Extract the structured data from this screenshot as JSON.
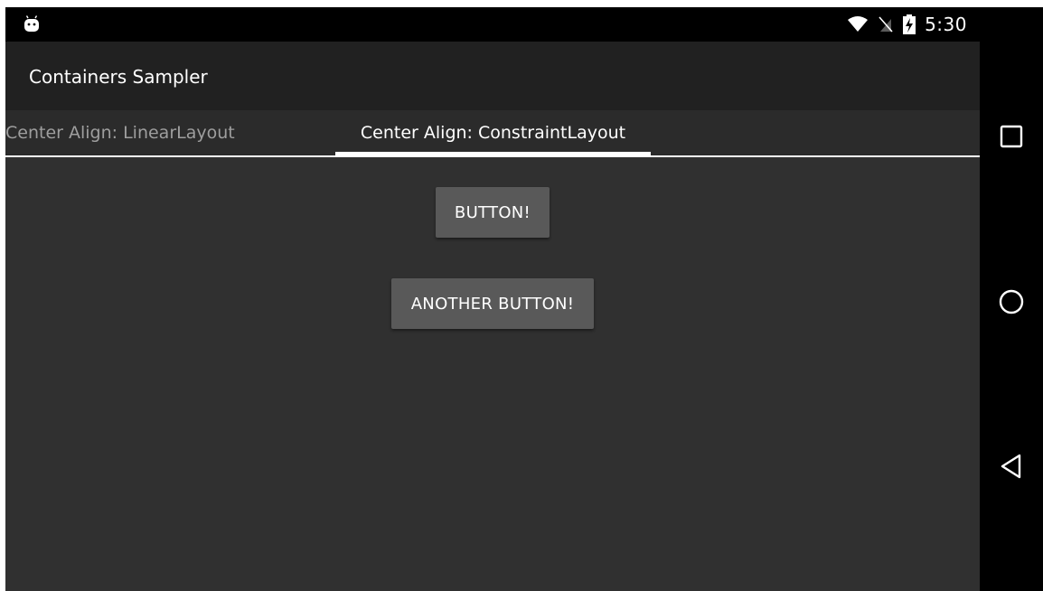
{
  "status_bar": {
    "time": "5:30",
    "icons": [
      "android-debug-icon",
      "wifi-icon",
      "no-sim-icon",
      "battery-charging-icon"
    ]
  },
  "action_bar": {
    "title": "Containers Sampler"
  },
  "tabs": [
    {
      "label": "Center Align: LinearLayout",
      "selected": false
    },
    {
      "label": "Center Align: ConstraintLayout",
      "selected": true
    }
  ],
  "content": {
    "button_1": "BUTTON!",
    "button_2": "ANOTHER BUTTON!"
  },
  "nav_bar": {
    "icons": [
      "recents-icon",
      "home-icon",
      "back-icon"
    ]
  },
  "colors": {
    "background": "#303030",
    "action_bar": "#212121",
    "tab_bar": "#2b2b2b",
    "button": "#595959",
    "tab_selected": "#ffffff",
    "tab_unselected": "#9e9e9e"
  }
}
